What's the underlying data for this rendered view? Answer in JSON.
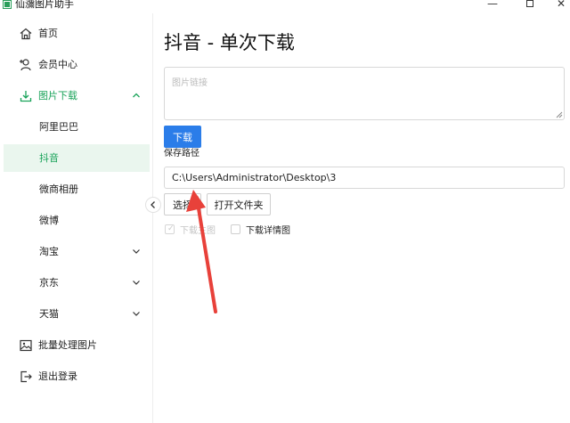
{
  "app": {
    "title": "仙瀰图片助手"
  },
  "window_controls": {
    "minimize": "—",
    "close": "✕"
  },
  "sidebar": {
    "items": [
      {
        "label": "首页",
        "icon": "home-icon"
      },
      {
        "label": "会员中心",
        "icon": "user-add-icon"
      },
      {
        "label": "图片下载",
        "icon": "download-icon",
        "expanded": true
      },
      {
        "label": "阿里巴巴"
      },
      {
        "label": "抖音",
        "selected": true
      },
      {
        "label": "微商相册"
      },
      {
        "label": "微博"
      },
      {
        "label": "淘宝",
        "has_children": true
      },
      {
        "label": "京东",
        "has_children": true
      },
      {
        "label": "天猫",
        "has_children": true
      },
      {
        "label": "批量处理图片",
        "icon": "image-icon"
      },
      {
        "label": "退出登录",
        "icon": "logout-icon"
      }
    ]
  },
  "main": {
    "title": "抖音 - 单次下载",
    "link_placeholder": "图片链接",
    "link_value": "",
    "download_label": "下载",
    "save_path_label": "保存路径",
    "save_path_value": "C:\\Users\\Administrator\\Desktop\\3",
    "select_label": "选择",
    "open_folder_label": "打开文件夹",
    "checkbox_main_image": {
      "label": "下载主图",
      "checked": true,
      "disabled": true
    },
    "checkbox_detail_image": {
      "label": "下载详情图",
      "checked": false
    }
  },
  "colors": {
    "accent_green": "#1aa35a",
    "selected_bg": "#eaf6ee",
    "primary_button": "#2b7de9",
    "annotation_arrow": "#e8413a"
  }
}
